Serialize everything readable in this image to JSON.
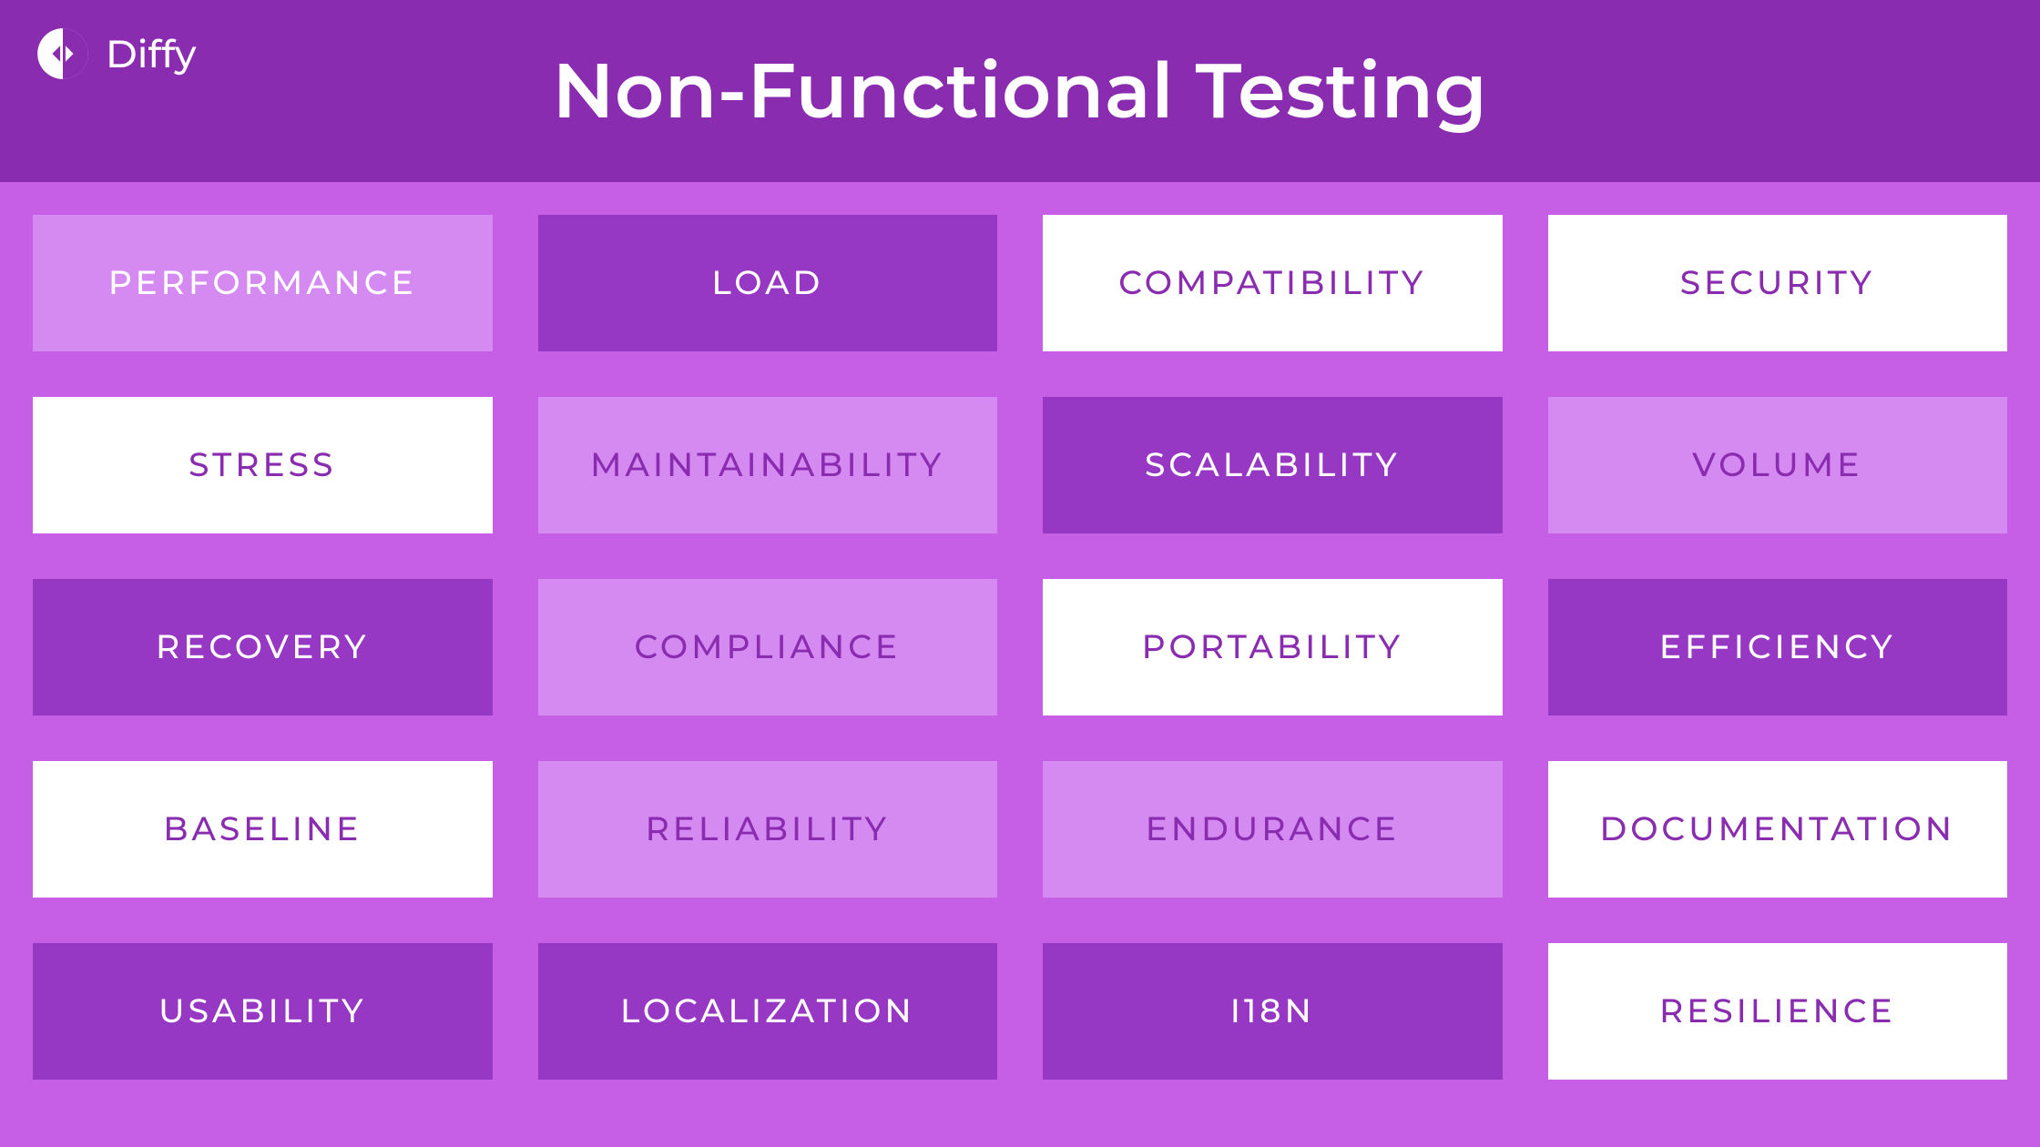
{
  "brand": "Diffy",
  "title": "Non-Functional Testing",
  "tiles": [
    {
      "label": "PERFORMANCE",
      "variant": "v-med"
    },
    {
      "label": "LOAD",
      "variant": "v-dark"
    },
    {
      "label": "COMPATIBILITY",
      "variant": "v-white"
    },
    {
      "label": "SECURITY",
      "variant": "v-white"
    },
    {
      "label": "STRESS",
      "variant": "v-white"
    },
    {
      "label": "MAINTAINABILITY",
      "variant": "v-light"
    },
    {
      "label": "SCALABILITY",
      "variant": "v-dark"
    },
    {
      "label": "VOLUME",
      "variant": "v-light"
    },
    {
      "label": "RECOVERY",
      "variant": "v-dark"
    },
    {
      "label": "COMPLIANCE",
      "variant": "v-light"
    },
    {
      "label": "PORTABILITY",
      "variant": "v-white"
    },
    {
      "label": "EFFICIENCY",
      "variant": "v-dark"
    },
    {
      "label": "BASELINE",
      "variant": "v-white"
    },
    {
      "label": "RELIABILITY",
      "variant": "v-light"
    },
    {
      "label": "ENDURANCE",
      "variant": "v-light"
    },
    {
      "label": "DOCUMENTATION",
      "variant": "v-white"
    },
    {
      "label": "USABILITY",
      "variant": "v-dark"
    },
    {
      "label": "LOCALIZATION",
      "variant": "v-dark"
    },
    {
      "label": "I18N",
      "variant": "v-dark"
    },
    {
      "label": "RESILIENCE",
      "variant": "v-white"
    }
  ]
}
